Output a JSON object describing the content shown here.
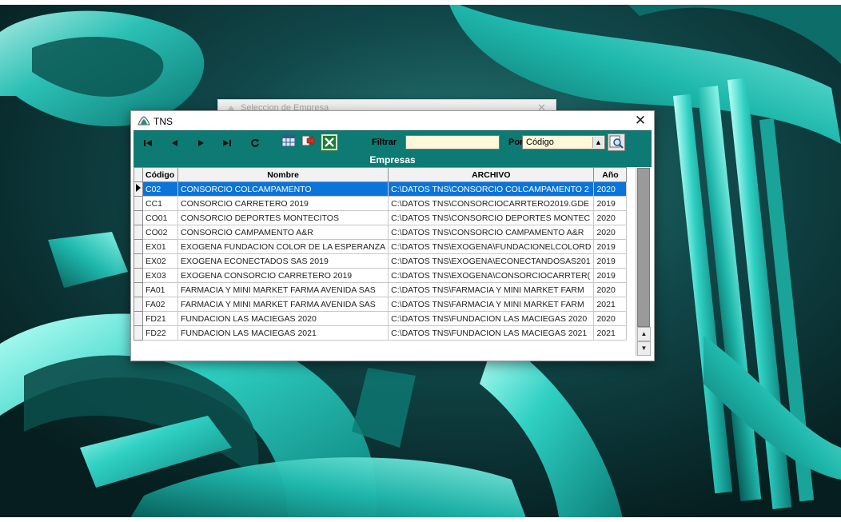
{
  "background_window": {
    "title": "Seleccion de Empresa",
    "close_glyph": "✕"
  },
  "window": {
    "title": "TNS",
    "close_glyph": "✕"
  },
  "toolbar": {
    "nav": {
      "first": "⏮",
      "prev": "◀",
      "next": "▶",
      "last": "⏭",
      "refresh": "↻"
    },
    "filter_label": "Filtrar",
    "filter_value": "",
    "by_label": "Por",
    "by_selected": "Código",
    "icons": [
      "grid-icon",
      "export-icon",
      "excel-icon",
      "search-icon"
    ]
  },
  "section": {
    "title": "Empresas"
  },
  "grid": {
    "columns": [
      "Código",
      "Nombre",
      "ARCHIVO",
      "Año"
    ],
    "rows": [
      {
        "codigo": "C02",
        "nombre": "CONSORCIO COLCAMPAMENTO",
        "archivo": "C:\\DATOS TNS\\CONSORCIO COLCAMPAMENTO 2",
        "ano": "2020",
        "selected": true
      },
      {
        "codigo": "CC1",
        "nombre": "CONSORCIO CARRETERO 2019",
        "archivo": "C:\\DATOS TNS\\CONSORCIOCARRTERO2019.GDE",
        "ano": "2019"
      },
      {
        "codigo": "CO01",
        "nombre": "CONSORCIO DEPORTES MONTECITOS",
        "archivo": "C:\\DATOS TNS\\CONSORCIO DEPORTES MONTEC",
        "ano": "2020"
      },
      {
        "codigo": "CO02",
        "nombre": "CONSORCIO CAMPAMENTO A&R",
        "archivo": "C:\\DATOS TNS\\CONSORCIO CAMPAMENTO A&R ",
        "ano": "2020"
      },
      {
        "codigo": "EX01",
        "nombre": "EXOGENA FUNDACION COLOR DE LA ESPERANZA",
        "archivo": "C:\\DATOS TNS\\EXOGENA\\FUNDACIONELCOLORD",
        "ano": "2019"
      },
      {
        "codigo": "EX02",
        "nombre": "EXOGENA ECONECTADOS SAS 2019",
        "archivo": "C:\\DATOS TNS\\EXOGENA\\ECONECTANDOSAS201",
        "ano": "2019"
      },
      {
        "codigo": "EX03",
        "nombre": "EXOGENA CONSORCIO CARRETERO 2019",
        "archivo": "C:\\DATOS TNS\\EXOGENA\\CONSORCIOCARRTER(",
        "ano": "2019"
      },
      {
        "codigo": "FA01",
        "nombre": "FARMACIA Y MINI MARKET FARMA AVENIDA SAS",
        "archivo": "C:\\DATOS TNS\\FARMACIA Y MINI MARKET FARM",
        "ano": "2020"
      },
      {
        "codigo": "FA02",
        "nombre": "FARMACIA Y MINI MARKET FARMA AVENIDA SAS",
        "archivo": "C:\\DATOS TNS\\FARMACIA Y MINI MARKET FARM",
        "ano": "2021"
      },
      {
        "codigo": "FD21",
        "nombre": "FUNDACION LAS MACIEGAS 2020",
        "archivo": "C:\\DATOS TNS\\FUNDACION LAS MACIEGAS 2020",
        "ano": "2020"
      },
      {
        "codigo": "FD22",
        "nombre": "FUNDACION LAS MACIEGAS 2021",
        "archivo": "C:\\DATOS TNS\\FUNDACION LAS MACIEGAS 2021",
        "ano": "2021"
      }
    ]
  },
  "colors": {
    "teal": "#0d7a73",
    "selection": "#0a74da",
    "filter_bg": "#fff8d8"
  }
}
